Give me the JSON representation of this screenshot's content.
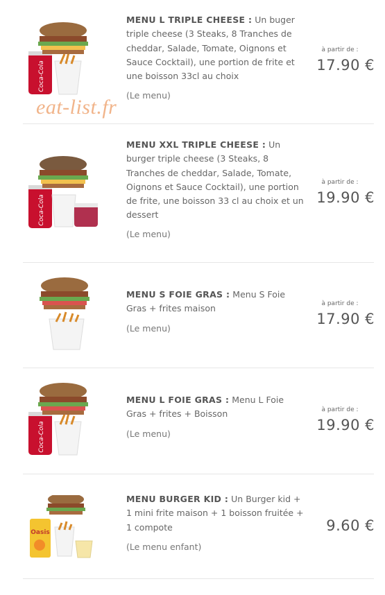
{
  "watermark": "eat-list.fr",
  "items": [
    {
      "name": "MENU L TRIPLE CHEESE :",
      "desc": " Un buger triple cheese (3 Steaks, 8 Tranches de cheddar, Salade, Tomate, Oignons et Sauce Cocktail), une portion de frite et une boisson 33cl au choix",
      "sub": "(Le menu)",
      "from": "à partir de :",
      "price": "17.90 €"
    },
    {
      "name": "MENU XXL TRIPLE CHEESE :",
      "desc": " Un burger triple cheese (3 Steaks, 8 Tranches de cheddar, Salade, Tomate, Oignons et Sauce Cocktail), une portion de frite, une boisson 33 cl au choix et un dessert",
      "sub": "(Le menu)",
      "from": "à partir de :",
      "price": "19.90 €"
    },
    {
      "name": "MENU S FOIE GRAS :",
      "desc": " Menu S Foie Gras + frites maison",
      "sub": "(Le menu)",
      "from": "à partir de :",
      "price": "17.90 €"
    },
    {
      "name": "MENU L FOIE GRAS :",
      "desc": " Menu L Foie Gras + frites + Boisson",
      "sub": "(Le menu)",
      "from": "à partir de :",
      "price": "19.90 €"
    },
    {
      "name": "MENU BURGER KID :",
      "desc": " Un Burger kid + 1 mini frite maison + 1 boisson fruitée + 1 compote",
      "sub": "(Le menu enfant)",
      "from": "",
      "price": "9.60 €"
    }
  ]
}
